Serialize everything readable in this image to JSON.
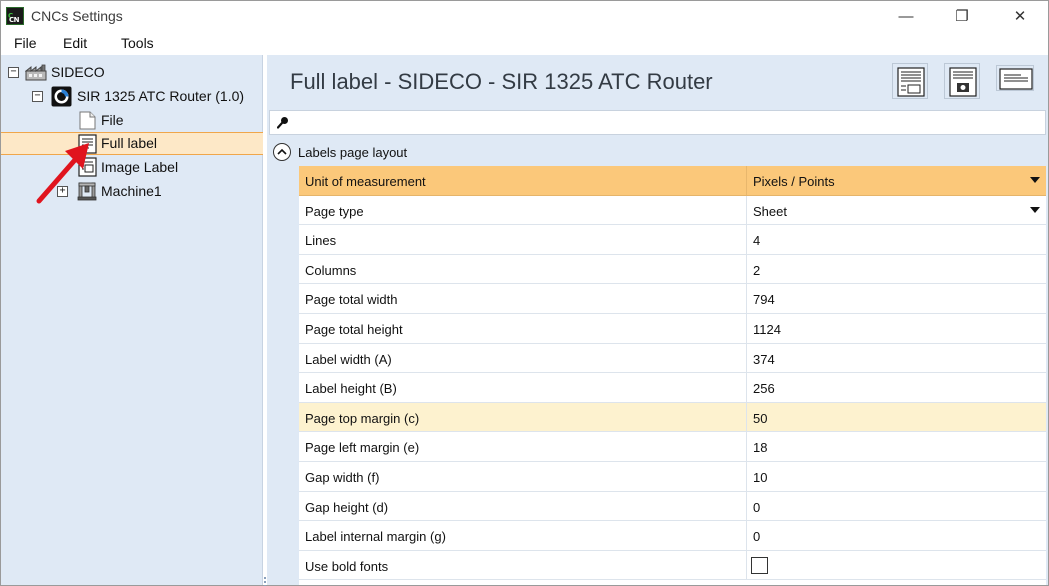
{
  "window": {
    "title": "CNCs Settings",
    "app_icon_text_a": "CN",
    "app_icon_text_b": "C",
    "minimize_glyph": "—",
    "maximize_glyph": "❐",
    "close_glyph": "✕"
  },
  "menu": {
    "file": "File",
    "edit": "Edit",
    "tools": "Tools"
  },
  "tree": {
    "root": {
      "label": "SIDECO",
      "expander": "−",
      "icon": "factory-icon"
    },
    "machine": {
      "label": "SIR 1325 ATC Router (1.0)",
      "expander": "−",
      "icon": "router-icon"
    },
    "items": [
      {
        "label": "File",
        "icon": "file-icon",
        "selected": false
      },
      {
        "label": "Full label",
        "icon": "label-icon",
        "selected": true
      },
      {
        "label": "Image Label",
        "icon": "image-label-icon",
        "selected": false
      },
      {
        "label": "Machine1",
        "icon": "machine-icon",
        "expander": "+",
        "selected": false
      }
    ],
    "selected_border_color": "#f0a64a",
    "selected_bg_color": "#fde8c7"
  },
  "panel": {
    "title": "Full label - SIDECO - SIR 1325 ATC Router",
    "toolbar_icons": [
      "full-label-layout-icon",
      "image-label-layout-icon",
      "simple-label-layout-icon"
    ]
  },
  "search": {
    "icon": "search-icon",
    "value": ""
  },
  "property_grid": {
    "group_label": "Labels page layout",
    "rows": [
      {
        "name": "Unit of measurement",
        "value": "Pixels / Points",
        "dropdown": true,
        "highlight": "orange"
      },
      {
        "name": "Page type",
        "value": "Sheet",
        "dropdown": true,
        "highlight": ""
      },
      {
        "name": "Lines",
        "value": "4",
        "highlight": ""
      },
      {
        "name": "Columns",
        "value": "2",
        "highlight": ""
      },
      {
        "name": "Page total width",
        "value": "794",
        "highlight": ""
      },
      {
        "name": "Page total height",
        "value": "1124",
        "highlight": ""
      },
      {
        "name": "Label width (A)",
        "value": "374",
        "highlight": ""
      },
      {
        "name": "Label height (B)",
        "value": "256",
        "highlight": ""
      },
      {
        "name": "Page top margin (c)",
        "value": "50",
        "highlight": "yellow"
      },
      {
        "name": "Page left margin (e)",
        "value": "18",
        "highlight": ""
      },
      {
        "name": "Gap width (f)",
        "value": "10",
        "highlight": ""
      },
      {
        "name": "Gap height (d)",
        "value": "0",
        "highlight": ""
      },
      {
        "name": "Label internal margin (g)",
        "value": "0",
        "highlight": ""
      },
      {
        "name": "Use bold fonts",
        "value": "",
        "checkbox": true,
        "checked": false,
        "highlight": ""
      }
    ]
  },
  "colors": {
    "accent_orange": "#fbc87a",
    "selection_yellow": "#fdf2cf",
    "panel_blue": "#dfe9f5",
    "annotation_red": "#e0141e"
  }
}
